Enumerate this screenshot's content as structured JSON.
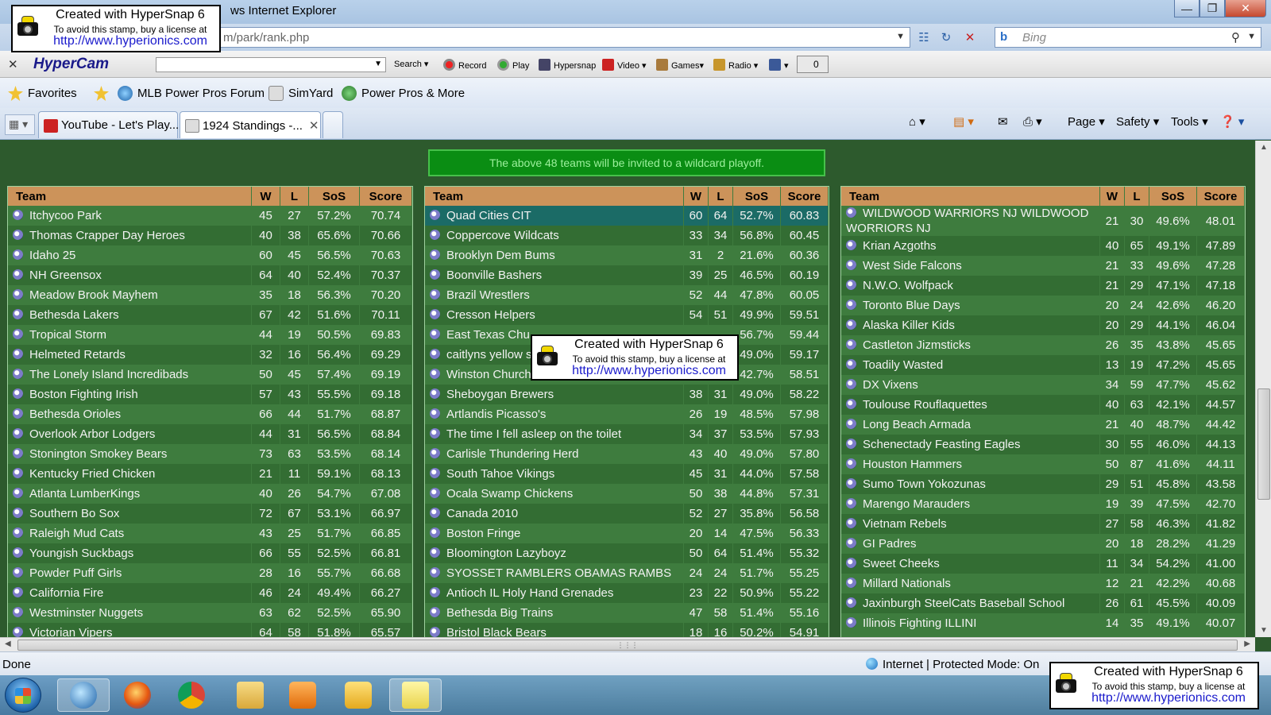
{
  "browser": {
    "title": "ws Internet Explorer",
    "address": "m/park/rank.php",
    "search_placeholder": "Bing",
    "window_buttons": [
      "minimize",
      "restore",
      "close"
    ]
  },
  "hypercam_toolbar": {
    "brand": "HyperCam",
    "items": [
      "Search",
      "Record",
      "Play",
      "Hypersnap",
      "Video",
      "Games",
      "Radio"
    ],
    "counter": "0"
  },
  "favorites_bar": {
    "favorites_label": "Favorites",
    "links": [
      "MLB Power Pros Forum",
      "SimYard",
      "Power Pros & More"
    ]
  },
  "tabs": [
    {
      "label": "YouTube - Let's Play...",
      "active": false
    },
    {
      "label": "1924 Standings -...",
      "active": true
    }
  ],
  "command_bar": {
    "page": "Page",
    "safety": "Safety",
    "tools": "Tools"
  },
  "notice": "The above 48 teams will be invited to a wildcard playoff.",
  "table_headers": {
    "team": "Team",
    "w": "W",
    "l": "L",
    "sos": "SoS",
    "score": "Score"
  },
  "columns": [
    {
      "rows": [
        [
          "Itchycoo Park",
          "45",
          "27",
          "57.2%",
          "70.74"
        ],
        [
          "Thomas Crapper Day Heroes",
          "40",
          "38",
          "65.6%",
          "70.66"
        ],
        [
          "Idaho 25",
          "60",
          "45",
          "56.5%",
          "70.63"
        ],
        [
          "NH Greensox",
          "64",
          "40",
          "52.4%",
          "70.37"
        ],
        [
          "Meadow Brook Mayhem",
          "35",
          "18",
          "56.3%",
          "70.20"
        ],
        [
          "Bethesda Lakers",
          "67",
          "42",
          "51.6%",
          "70.11"
        ],
        [
          "Tropical Storm",
          "44",
          "19",
          "50.5%",
          "69.83"
        ],
        [
          "Helmeted Retards",
          "32",
          "16",
          "56.4%",
          "69.29"
        ],
        [
          "The Lonely Island Incredibads",
          "50",
          "45",
          "57.4%",
          "69.19"
        ],
        [
          "Boston Fighting Irish",
          "57",
          "43",
          "55.5%",
          "69.18"
        ],
        [
          "Bethesda Orioles",
          "66",
          "44",
          "51.7%",
          "68.87"
        ],
        [
          "Overlook Arbor Lodgers",
          "44",
          "31",
          "56.5%",
          "68.84"
        ],
        [
          "Stonington Smokey Bears",
          "73",
          "63",
          "53.5%",
          "68.14"
        ],
        [
          "Kentucky Fried Chicken",
          "21",
          "11",
          "59.1%",
          "68.13"
        ],
        [
          "Atlanta LumberKings",
          "40",
          "26",
          "54.7%",
          "67.08"
        ],
        [
          "Southern Bo Sox",
          "72",
          "67",
          "53.1%",
          "66.97"
        ],
        [
          "Raleigh Mud Cats",
          "43",
          "25",
          "51.7%",
          "66.85"
        ],
        [
          "Youngish Suckbags",
          "66",
          "55",
          "52.5%",
          "66.81"
        ],
        [
          "Powder Puff Girls",
          "28",
          "16",
          "55.7%",
          "66.68"
        ],
        [
          "California Fire",
          "46",
          "24",
          "49.4%",
          "66.27"
        ],
        [
          "Westminster Nuggets",
          "63",
          "62",
          "52.5%",
          "65.90"
        ],
        [
          "Victorian Vipers",
          "64",
          "58",
          "51.8%",
          "65.57"
        ]
      ]
    },
    {
      "rows": [
        [
          "Quad Cities CIT",
          "60",
          "64",
          "52.7%",
          "60.83"
        ],
        [
          "Coppercove Wildcats",
          "33",
          "34",
          "56.8%",
          "60.45"
        ],
        [
          "Brooklyn Dem Bums",
          "31",
          "2",
          "21.6%",
          "60.36"
        ],
        [
          "Boonville Bashers",
          "39",
          "25",
          "46.5%",
          "60.19"
        ],
        [
          "Brazil Wrestlers",
          "52",
          "44",
          "47.8%",
          "60.05"
        ],
        [
          "Cresson Helpers",
          "54",
          "51",
          "49.9%",
          "59.51"
        ],
        [
          "East Texas Chu",
          "",
          "",
          "56.7%",
          "59.44"
        ],
        [
          "caitlyns yellow s",
          "",
          "",
          "49.0%",
          "59.17"
        ],
        [
          "Winston Church",
          "",
          "",
          "42.7%",
          "58.51"
        ],
        [
          "Sheboygan Brewers",
          "38",
          "31",
          "49.0%",
          "58.22"
        ],
        [
          "Artlandis Picasso's",
          "26",
          "19",
          "48.5%",
          "57.98"
        ],
        [
          "The time I fell asleep on the toilet",
          "34",
          "37",
          "53.5%",
          "57.93"
        ],
        [
          "Carlisle Thundering Herd",
          "43",
          "40",
          "49.0%",
          "57.80"
        ],
        [
          "South Tahoe Vikings",
          "45",
          "31",
          "44.0%",
          "57.58"
        ],
        [
          "Ocala Swamp Chickens",
          "50",
          "38",
          "44.8%",
          "57.31"
        ],
        [
          "Canada 2010",
          "52",
          "27",
          "35.8%",
          "56.58"
        ],
        [
          "Boston Fringe",
          "20",
          "14",
          "47.5%",
          "56.33"
        ],
        [
          "Bloomington Lazyboyz",
          "50",
          "64",
          "51.4%",
          "55.32"
        ],
        [
          "SYOSSET RAMBLERS OBAMAS RAMBS",
          "24",
          "24",
          "51.7%",
          "55.25"
        ],
        [
          "Antioch IL Holy Hand Grenades",
          "23",
          "22",
          "50.9%",
          "55.22"
        ],
        [
          "Bethesda Big Trains",
          "47",
          "58",
          "51.4%",
          "55.16"
        ],
        [
          "Bristol Black Bears",
          "18",
          "16",
          "50.2%",
          "54.91"
        ]
      ]
    },
    {
      "rows": [
        [
          "WILDWOOD WARRIORS NJ WILDWOOD WORRIORS NJ",
          "21",
          "30",
          "49.6%",
          "48.01"
        ],
        [
          "Krian Azgoths",
          "40",
          "65",
          "49.1%",
          "47.89"
        ],
        [
          "West Side Falcons",
          "21",
          "33",
          "49.6%",
          "47.28"
        ],
        [
          "N.W.O. Wolfpack",
          "21",
          "29",
          "47.1%",
          "47.18"
        ],
        [
          "Toronto Blue Days",
          "20",
          "24",
          "42.6%",
          "46.20"
        ],
        [
          "Alaska Killer Kids",
          "20",
          "29",
          "44.1%",
          "46.04"
        ],
        [
          "Castleton Jizmsticks",
          "26",
          "35",
          "43.8%",
          "45.65"
        ],
        [
          "Toadily Wasted",
          "13",
          "19",
          "47.2%",
          "45.65"
        ],
        [
          "DX Vixens",
          "34",
          "59",
          "47.7%",
          "45.62"
        ],
        [
          "Toulouse Rouflaquettes",
          "40",
          "63",
          "42.1%",
          "44.57"
        ],
        [
          "Long Beach Armada",
          "21",
          "40",
          "48.7%",
          "44.42"
        ],
        [
          "Schenectady Feasting Eagles",
          "30",
          "55",
          "46.0%",
          "44.13"
        ],
        [
          "Houston Hammers",
          "50",
          "87",
          "41.6%",
          "44.11"
        ],
        [
          "Sumo Town Yokozunas",
          "29",
          "51",
          "45.8%",
          "43.58"
        ],
        [
          "Marengo Marauders",
          "19",
          "39",
          "47.5%",
          "42.70"
        ],
        [
          "Vietnam Rebels",
          "27",
          "58",
          "46.3%",
          "41.82"
        ],
        [
          "GI Padres",
          "20",
          "18",
          "28.2%",
          "41.29"
        ],
        [
          "Sweet Cheeks",
          "11",
          "34",
          "54.2%",
          "41.00"
        ],
        [
          "Millard Nationals",
          "12",
          "21",
          "42.2%",
          "40.68"
        ],
        [
          "Jaxinburgh SteelCats Baseball School",
          "26",
          "61",
          "45.5%",
          "40.09"
        ],
        [
          "Illinois Fighting ILLINI",
          "14",
          "35",
          "49.1%",
          "40.07"
        ]
      ]
    }
  ],
  "status": {
    "left": "Done",
    "zone": "Internet | Protected Mode: On"
  },
  "stamp": {
    "line1": "Created with HyperSnap 6",
    "line2": "To avoid this stamp, buy a license at",
    "line3": "http://www.hyperionics.com"
  }
}
